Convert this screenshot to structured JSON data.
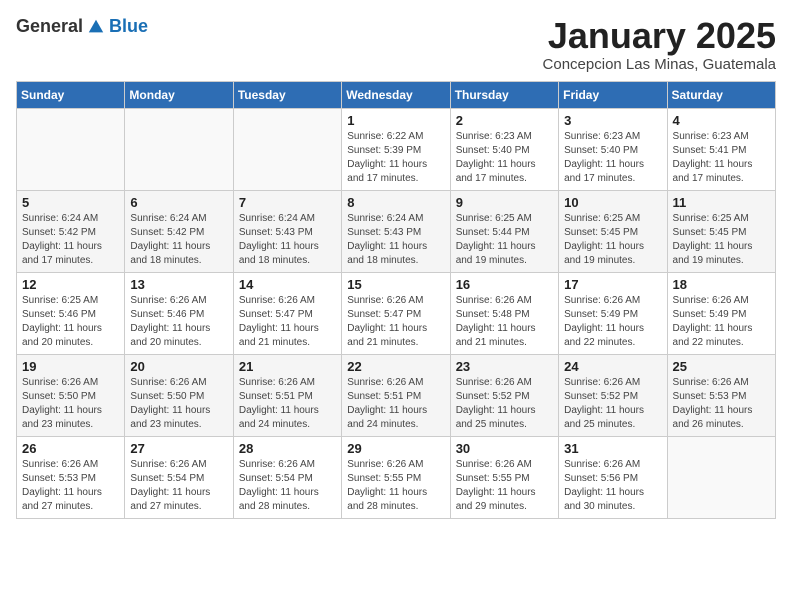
{
  "header": {
    "logo_general": "General",
    "logo_blue": "Blue",
    "month_title": "January 2025",
    "subtitle": "Concepcion Las Minas, Guatemala"
  },
  "days_of_week": [
    "Sunday",
    "Monday",
    "Tuesday",
    "Wednesday",
    "Thursday",
    "Friday",
    "Saturday"
  ],
  "weeks": [
    [
      {
        "day": "",
        "info": ""
      },
      {
        "day": "",
        "info": ""
      },
      {
        "day": "",
        "info": ""
      },
      {
        "day": "1",
        "info": "Sunrise: 6:22 AM\nSunset: 5:39 PM\nDaylight: 11 hours and 17 minutes."
      },
      {
        "day": "2",
        "info": "Sunrise: 6:23 AM\nSunset: 5:40 PM\nDaylight: 11 hours and 17 minutes."
      },
      {
        "day": "3",
        "info": "Sunrise: 6:23 AM\nSunset: 5:40 PM\nDaylight: 11 hours and 17 minutes."
      },
      {
        "day": "4",
        "info": "Sunrise: 6:23 AM\nSunset: 5:41 PM\nDaylight: 11 hours and 17 minutes."
      }
    ],
    [
      {
        "day": "5",
        "info": "Sunrise: 6:24 AM\nSunset: 5:42 PM\nDaylight: 11 hours and 17 minutes."
      },
      {
        "day": "6",
        "info": "Sunrise: 6:24 AM\nSunset: 5:42 PM\nDaylight: 11 hours and 18 minutes."
      },
      {
        "day": "7",
        "info": "Sunrise: 6:24 AM\nSunset: 5:43 PM\nDaylight: 11 hours and 18 minutes."
      },
      {
        "day": "8",
        "info": "Sunrise: 6:24 AM\nSunset: 5:43 PM\nDaylight: 11 hours and 18 minutes."
      },
      {
        "day": "9",
        "info": "Sunrise: 6:25 AM\nSunset: 5:44 PM\nDaylight: 11 hours and 19 minutes."
      },
      {
        "day": "10",
        "info": "Sunrise: 6:25 AM\nSunset: 5:45 PM\nDaylight: 11 hours and 19 minutes."
      },
      {
        "day": "11",
        "info": "Sunrise: 6:25 AM\nSunset: 5:45 PM\nDaylight: 11 hours and 19 minutes."
      }
    ],
    [
      {
        "day": "12",
        "info": "Sunrise: 6:25 AM\nSunset: 5:46 PM\nDaylight: 11 hours and 20 minutes."
      },
      {
        "day": "13",
        "info": "Sunrise: 6:26 AM\nSunset: 5:46 PM\nDaylight: 11 hours and 20 minutes."
      },
      {
        "day": "14",
        "info": "Sunrise: 6:26 AM\nSunset: 5:47 PM\nDaylight: 11 hours and 21 minutes."
      },
      {
        "day": "15",
        "info": "Sunrise: 6:26 AM\nSunset: 5:47 PM\nDaylight: 11 hours and 21 minutes."
      },
      {
        "day": "16",
        "info": "Sunrise: 6:26 AM\nSunset: 5:48 PM\nDaylight: 11 hours and 21 minutes."
      },
      {
        "day": "17",
        "info": "Sunrise: 6:26 AM\nSunset: 5:49 PM\nDaylight: 11 hours and 22 minutes."
      },
      {
        "day": "18",
        "info": "Sunrise: 6:26 AM\nSunset: 5:49 PM\nDaylight: 11 hours and 22 minutes."
      }
    ],
    [
      {
        "day": "19",
        "info": "Sunrise: 6:26 AM\nSunset: 5:50 PM\nDaylight: 11 hours and 23 minutes."
      },
      {
        "day": "20",
        "info": "Sunrise: 6:26 AM\nSunset: 5:50 PM\nDaylight: 11 hours and 23 minutes."
      },
      {
        "day": "21",
        "info": "Sunrise: 6:26 AM\nSunset: 5:51 PM\nDaylight: 11 hours and 24 minutes."
      },
      {
        "day": "22",
        "info": "Sunrise: 6:26 AM\nSunset: 5:51 PM\nDaylight: 11 hours and 24 minutes."
      },
      {
        "day": "23",
        "info": "Sunrise: 6:26 AM\nSunset: 5:52 PM\nDaylight: 11 hours and 25 minutes."
      },
      {
        "day": "24",
        "info": "Sunrise: 6:26 AM\nSunset: 5:52 PM\nDaylight: 11 hours and 25 minutes."
      },
      {
        "day": "25",
        "info": "Sunrise: 6:26 AM\nSunset: 5:53 PM\nDaylight: 11 hours and 26 minutes."
      }
    ],
    [
      {
        "day": "26",
        "info": "Sunrise: 6:26 AM\nSunset: 5:53 PM\nDaylight: 11 hours and 27 minutes."
      },
      {
        "day": "27",
        "info": "Sunrise: 6:26 AM\nSunset: 5:54 PM\nDaylight: 11 hours and 27 minutes."
      },
      {
        "day": "28",
        "info": "Sunrise: 6:26 AM\nSunset: 5:54 PM\nDaylight: 11 hours and 28 minutes."
      },
      {
        "day": "29",
        "info": "Sunrise: 6:26 AM\nSunset: 5:55 PM\nDaylight: 11 hours and 28 minutes."
      },
      {
        "day": "30",
        "info": "Sunrise: 6:26 AM\nSunset: 5:55 PM\nDaylight: 11 hours and 29 minutes."
      },
      {
        "day": "31",
        "info": "Sunrise: 6:26 AM\nSunset: 5:56 PM\nDaylight: 11 hours and 30 minutes."
      },
      {
        "day": "",
        "info": ""
      }
    ]
  ]
}
